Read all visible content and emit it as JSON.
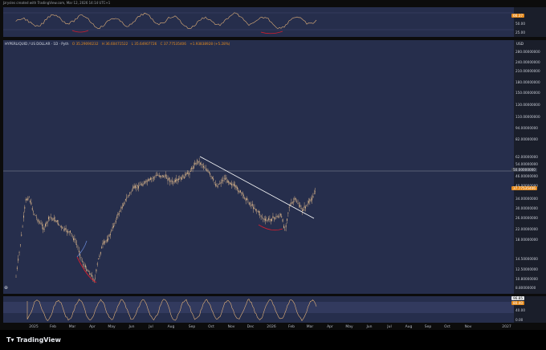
{
  "credit": "Jzrysles created with TradingView.com, Mar 12, 2026 14:14 UTC+1",
  "legend": {
    "symbol": "HYPERLIQUID / US DOLLAR · 1D · Pyth",
    "open": "O 35.29090232",
    "high": "H 36.60471522",
    "low": "L 35.64907726",
    "close": "C 37.77535406",
    "change": "+1.93838928 (+5.28%)"
  },
  "currency": "USD",
  "price_scale": [
    "280.00000000",
    "240.00000000",
    "210.00000000",
    "180.00000000",
    "150.00000000",
    "130.00000000",
    "110.00000000",
    "94.00000000",
    "82.00000000",
    "62.00000000",
    "54.00000000",
    "46.00000000",
    "40.00000000",
    "34.00000000",
    "30.00000000",
    "26.00000000",
    "22.00000000",
    "18.00000000",
    "14.50000000",
    "12.50000000",
    "10.80000000",
    "8.80000000"
  ],
  "badges": {
    "horizontal_level": "50.00000000",
    "last_price": "37.77535406",
    "top_rsi": "66.37",
    "bottom_a": "96.85",
    "bottom_b": "80.40"
  },
  "top_scale": [
    "50.00",
    "25.00"
  ],
  "bottom_scale": [
    "40.00",
    "0.00"
  ],
  "time_axis": [
    "2025",
    "Feb",
    "Mar",
    "Apr",
    "May",
    "Jun",
    "Jul",
    "Aug",
    "Sep",
    "Oct",
    "Nov",
    "Dec",
    "2026",
    "Feb",
    "Mar",
    "Apr",
    "May",
    "Jun",
    "Jul",
    "Aug",
    "Sep",
    "Oct",
    "Nov",
    "2027"
  ],
  "colors": {
    "panel": "#262e4c",
    "candle": "#d9b48a",
    "trendline": "#ffffff",
    "level_line": "#8a8f9c",
    "last_price_badge": "#e48a1e",
    "divergence": "#d21e2e",
    "rsi": "#e3b27a"
  },
  "brand": "TradingView"
}
